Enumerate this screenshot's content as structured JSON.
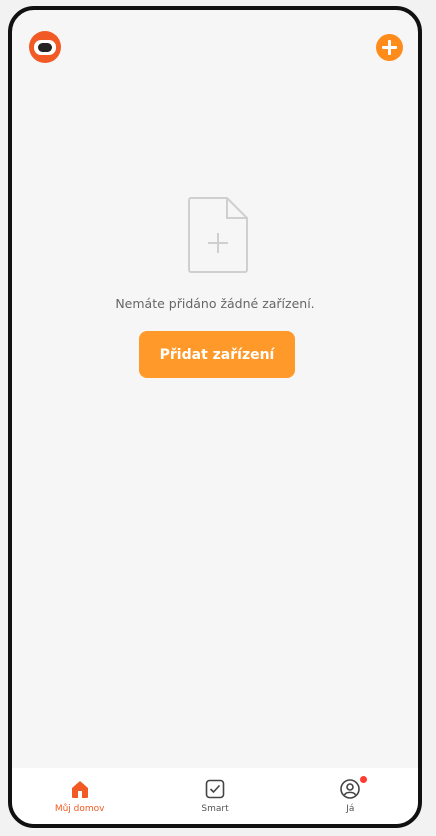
{
  "empty_state": {
    "icon": "document-add-icon",
    "message": "Nemáte přidáno žádné zařízení.",
    "button_label": "Přidat zařízení"
  },
  "topbar": {
    "avatar_icon": "robot-avatar-icon",
    "add_icon": "plus-circle-icon"
  },
  "tabbar": {
    "tabs": [
      {
        "label": "Můj domov",
        "icon": "home-icon",
        "active": true
      },
      {
        "label": "Smart",
        "icon": "checkbox-icon",
        "active": false
      },
      {
        "label": "Já",
        "icon": "user-icon",
        "active": false,
        "badge": true
      }
    ]
  },
  "colors": {
    "accent": "#ff9a2a",
    "brand": "#f15a24",
    "badge": "#ff3b30"
  }
}
